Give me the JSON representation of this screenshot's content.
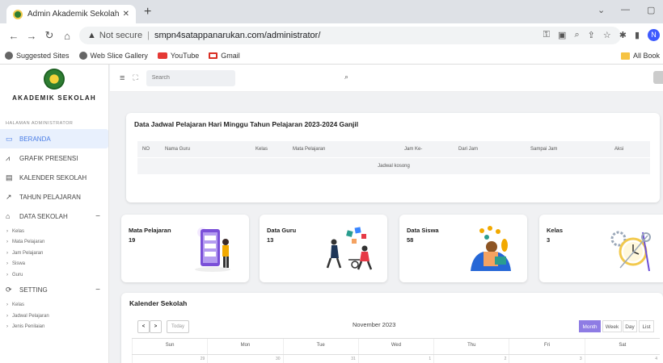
{
  "browser": {
    "tab_title": "Admin Akademik Sekolah SMPN",
    "tab_close": "✕",
    "new_tab": "+",
    "url_security": "Not secure",
    "url": "smpn4satappanarukan.com/administrator/",
    "profile_initial": "N",
    "bookmarks": [
      {
        "label": "Suggested Sites",
        "icon": "globe-icon"
      },
      {
        "label": "Web Slice Gallery",
        "icon": "globe-icon"
      },
      {
        "label": "YouTube",
        "icon": "youtube-icon"
      },
      {
        "label": "Gmail",
        "icon": "gmail-icon"
      }
    ],
    "all_bookmarks": "All Book"
  },
  "sidebar": {
    "brand": "AKADEMIK SEKOLAH",
    "section": "HALAMAN ADMINISTRATOR",
    "items": [
      {
        "label": "BERANDA",
        "icon": "monitor-icon"
      },
      {
        "label": "GRAFIK PRESENSI",
        "icon": "chart-icon"
      },
      {
        "label": "KALENDER SEKOLAH",
        "icon": "calendar-icon"
      },
      {
        "label": "TAHUN PELAJARAN",
        "icon": "trend-icon"
      },
      {
        "label": "DATA SEKOLAH",
        "icon": "school-icon"
      },
      {
        "label": "SETTING",
        "icon": "refresh-icon"
      }
    ],
    "data_sekolah_subs": [
      "Kelas",
      "Mata Pelajaran",
      "Jam Pelajaran",
      "Siswa",
      "Guru"
    ],
    "setting_subs": [
      "Kelas",
      "Jadwal Pelajaran",
      "Jenis Penilaian"
    ]
  },
  "topbar": {
    "search_placeholder": "Search"
  },
  "jadwal": {
    "title": "Data Jadwal Pelajaran Hari Minggu Tahun Pelajaran 2023-2024 Ganjil",
    "columns": [
      "NO",
      "Nama Guru",
      "Kelas",
      "Mata Pelajaran",
      "Jam Ke-",
      "Dari Jam",
      "Sampai Jam",
      "Aksi"
    ],
    "empty": "Jadwal kosong"
  },
  "stats": [
    {
      "label": "Mata Pelajaran",
      "value": "19"
    },
    {
      "label": "Data Guru",
      "value": "13"
    },
    {
      "label": "Data Siswa",
      "value": "58"
    },
    {
      "label": "Kelas",
      "value": "3"
    }
  ],
  "kalender": {
    "title": "Kalender Sekolah",
    "prev": "<",
    "next": ">",
    "today": "Today",
    "month": "November 2023",
    "views": [
      "Month",
      "Week",
      "Day",
      "List"
    ],
    "days": [
      "Sun",
      "Mon",
      "Tue",
      "Wed",
      "Thu",
      "Fri",
      "Sat"
    ],
    "first_row_dates": [
      "29",
      "30",
      "31",
      "1",
      "2",
      "3",
      "4"
    ]
  },
  "colors": {
    "accent": "#4a7de6",
    "active_view": "#8e7ce4"
  }
}
